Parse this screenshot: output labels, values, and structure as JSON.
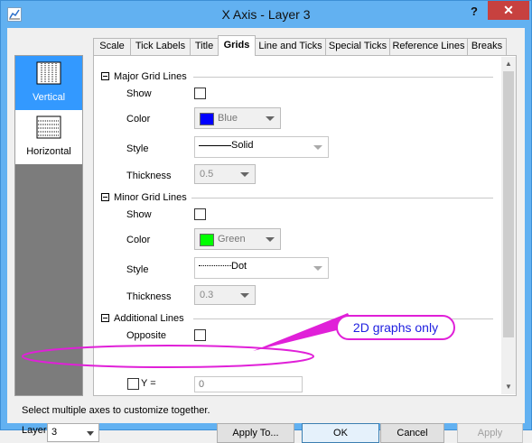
{
  "window": {
    "title": "X Axis - Layer 3",
    "help_label": "?",
    "close_label": "✕"
  },
  "axis_list": [
    {
      "label": "Vertical",
      "selected": true
    },
    {
      "label": "Horizontal",
      "selected": false
    }
  ],
  "tabs": [
    {
      "label": "Scale",
      "active": false
    },
    {
      "label": "Tick Labels",
      "active": false
    },
    {
      "label": "Title",
      "active": false
    },
    {
      "label": "Grids",
      "active": true
    },
    {
      "label": "Line and Ticks",
      "active": false
    },
    {
      "label": "Special Ticks",
      "active": false
    },
    {
      "label": "Reference Lines",
      "active": false
    },
    {
      "label": "Breaks",
      "active": false
    }
  ],
  "major": {
    "header": "Major Grid Lines",
    "show_label": "Show",
    "show_checked": false,
    "color_label": "Color",
    "color_value": "Blue",
    "color_swatch": "#0000ff",
    "style_label": "Style",
    "style_value": "Solid",
    "thickness_label": "Thickness",
    "thickness_value": "0.5"
  },
  "minor": {
    "header": "Minor Grid Lines",
    "show_label": "Show",
    "show_checked": false,
    "color_label": "Color",
    "color_value": "Green",
    "color_swatch": "#00ff00",
    "style_label": "Style",
    "style_value": "Dot",
    "thickness_label": "Thickness",
    "thickness_value": "0.3"
  },
  "additional": {
    "header": "Additional Lines",
    "opposite_label": "Opposite",
    "opposite_checked": false,
    "y_label": "Y =",
    "y_checked": false,
    "y_value": "0"
  },
  "callout": {
    "text": "2D graphs only",
    "color": "#e020d8"
  },
  "footer": {
    "hint": "Select multiple axes to customize together.",
    "layer_label": "Layer",
    "layer_value": "3",
    "apply_to_label": "Apply To...",
    "ok_label": "OK",
    "cancel_label": "Cancel",
    "apply_label": "Apply"
  }
}
